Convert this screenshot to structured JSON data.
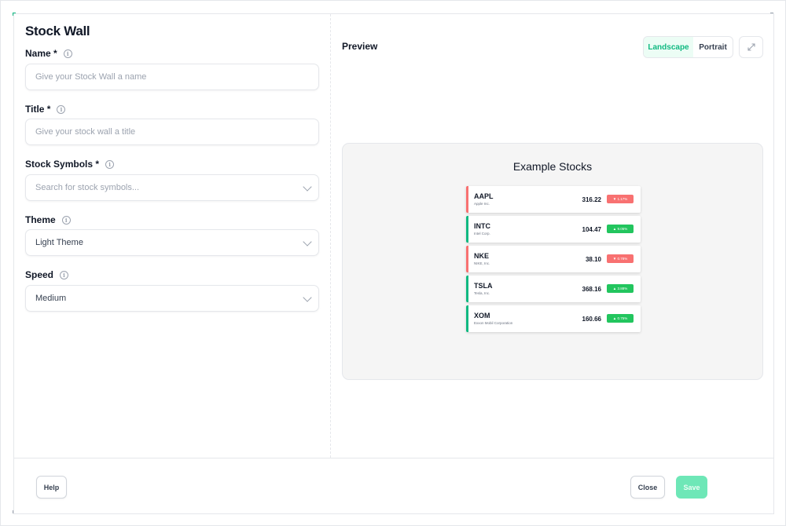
{
  "form": {
    "title": "Stock Wall",
    "name": {
      "label": "Name *",
      "placeholder": "Give your Stock Wall a name"
    },
    "title_field": {
      "label": "Title *",
      "placeholder": "Give your stock wall a title"
    },
    "symbols": {
      "label": "Stock Symbols *",
      "placeholder": "Search for stock symbols..."
    },
    "theme": {
      "label": "Theme",
      "value": "Light Theme"
    },
    "speed": {
      "label": "Speed",
      "value": "Medium"
    }
  },
  "preview": {
    "label": "Preview",
    "orientation": {
      "landscape": "Landscape",
      "portrait": "Portrait",
      "selected": "Landscape"
    },
    "canvas_title": "Example Stocks",
    "stocks": [
      {
        "symbol": "AAPL",
        "name": "Apple Inc.",
        "price": "316.22",
        "change": "▼ 1.17%",
        "direction": "down"
      },
      {
        "symbol": "INTC",
        "name": "Intel Corp.",
        "price": "104.47",
        "change": "▲ 9.05%",
        "direction": "up"
      },
      {
        "symbol": "NKE",
        "name": "NIKE, Inc.",
        "price": "38.10",
        "change": "▼ 0.78%",
        "direction": "down"
      },
      {
        "symbol": "TSLA",
        "name": "Tesla, Inc.",
        "price": "368.16",
        "change": "▲ 3.88%",
        "direction": "up"
      },
      {
        "symbol": "XOM",
        "name": "Exxon Mobil Corporation",
        "price": "160.66",
        "change": "▲ 0.75%",
        "direction": "up"
      }
    ]
  },
  "footer": {
    "help": "Help",
    "close": "Close",
    "save": "Save"
  },
  "colors": {
    "accent": "#10b981",
    "up": "#22c55e",
    "down": "#f87171",
    "save_disabled": "#6ee7b7"
  },
  "icons": {
    "info": "info-icon",
    "chevron": "chevron-down-icon",
    "expand": "expand-icon"
  }
}
